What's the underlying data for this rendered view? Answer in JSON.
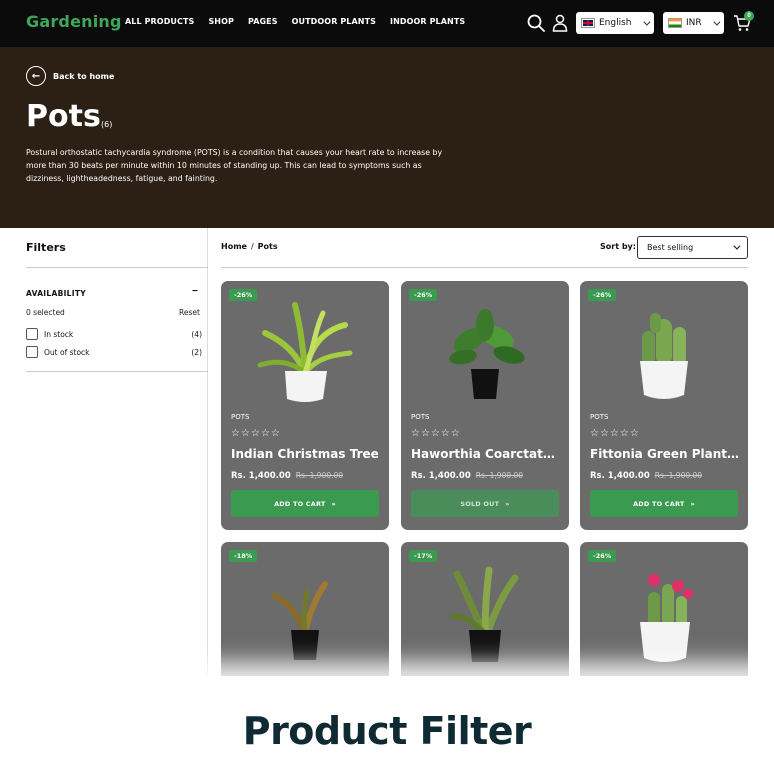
{
  "nav": {
    "logo": "Gardening",
    "menu": [
      "ALL PRODUCTS",
      "SHOP",
      "PAGES",
      "OUTDOOR PLANTS",
      "INDOOR PLANTS"
    ],
    "language": "English",
    "currency": "INR",
    "cart_count": "0"
  },
  "hero": {
    "back_label": "Back to home",
    "title": "Pots",
    "count": "(6)",
    "description": "Postural orthostatic tachycardia syndrome (POTS) is a condition that causes your heart rate to increase by more than 30 beats per minute within 10 minutes of standing up. This can lead to symptoms such as dizziness, lightheadedness, fatigue, and fainting."
  },
  "filters": {
    "title": "Filters",
    "availability_label": "AVAILABILITY",
    "selected": "0 selected",
    "reset": "Reset",
    "options": [
      {
        "label": "In stock",
        "count": "(4)"
      },
      {
        "label": "Out of stock",
        "count": "(2)"
      }
    ]
  },
  "breadcrumb": {
    "home": "Home",
    "current": "Pots"
  },
  "sort": {
    "label": "Sort by:",
    "value": "Best selling"
  },
  "products": [
    {
      "badge": "-26%",
      "category": "POTS",
      "name": "Indian Christmas Tree",
      "price": "Rs. 1,400.00",
      "old_price": "Rs. 1,900.00",
      "cta": "ADD TO CART",
      "stars": "☆☆☆☆☆"
    },
    {
      "badge": "-26%",
      "category": "POTS",
      "name": "Haworthia Coarctata...",
      "price": "Rs. 1,400.00",
      "old_price": "Rs. 1,900.00",
      "cta": "SOLD OUT",
      "stars": "☆☆☆☆☆"
    },
    {
      "badge": "-26%",
      "category": "POTS",
      "name": "Fittonia Green Plant...",
      "price": "Rs. 1,400.00",
      "old_price": "Rs. 1,900.00",
      "cta": "ADD TO CART",
      "stars": "☆☆☆☆☆"
    },
    {
      "badge": "-18%"
    },
    {
      "badge": "-17%"
    },
    {
      "badge": "-26%"
    }
  ],
  "banner": {
    "title": "Product Filter"
  },
  "colors": {
    "accent": "#3a9a4f",
    "hero_bg": "#2b2013",
    "nav_bg": "#0b0b0b",
    "card_bg": "#6b6b6b"
  }
}
